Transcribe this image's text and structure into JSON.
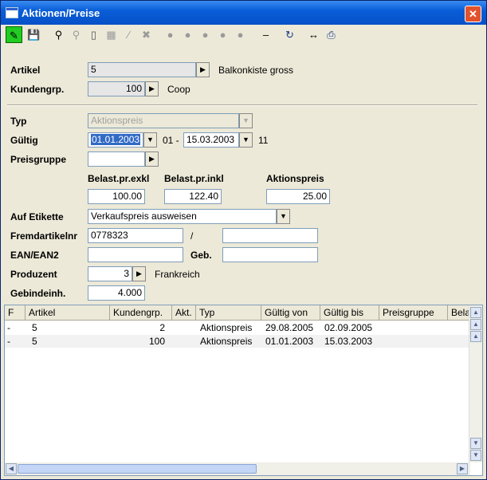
{
  "window": {
    "title": "Aktionen/Preise",
    "close_label": "✕"
  },
  "toolbar": {
    "icons": [
      "edit-icon",
      "save-icon",
      "binoculars-icon",
      "search-icon",
      "new-document-icon",
      "grid-icon",
      "wand-icon",
      "delete-icon",
      "bomb-icon",
      "bomb-icon",
      "bomb-icon",
      "bomb-icon",
      "bomb-icon",
      "minus-icon",
      "refresh-icon",
      "fit-width-icon",
      "print-icon"
    ]
  },
  "form": {
    "artikel": {
      "label": "Artikel",
      "value": "5",
      "description": "Balkonkiste gross"
    },
    "kundengrp": {
      "label": "Kundengrp.",
      "value": "100",
      "description": "Coop"
    },
    "typ": {
      "label": "Typ",
      "value": "Aktionspreis"
    },
    "gueltig": {
      "label": "Gültig",
      "from": "01.01.2003",
      "sep": "01 -",
      "to": "15.03.2003",
      "count": "11"
    },
    "preisgruppe": {
      "label": "Preisgruppe",
      "value": ""
    },
    "belast_exkl": {
      "label": "Belast.pr.exkl",
      "value": "100.00"
    },
    "belast_inkl": {
      "label": "Belast.pr.inkl",
      "value": "122.40"
    },
    "aktionspreis": {
      "label": "Aktionspreis",
      "value": "25.00"
    },
    "etikette": {
      "label": "Auf Etikette",
      "value": "Verkaufspreis ausweisen"
    },
    "fremdartikelnr": {
      "label": "Fremdartikelnr",
      "value": "0778323",
      "slash": "/",
      "value2": ""
    },
    "ean": {
      "label": "EAN/EAN2",
      "value": "",
      "geb_label": "Geb.",
      "geb_value": ""
    },
    "produzent": {
      "label": "Produzent",
      "value": "3",
      "description": "Frankreich"
    },
    "gebindeinh": {
      "label": "Gebindeinh.",
      "value": "4.000"
    }
  },
  "table": {
    "columns": [
      "F",
      "Artikel",
      "Kundengrp.",
      "Akt.",
      "Typ",
      "Gültig von",
      "Gültig bis",
      "Preisgruppe",
      "Bela"
    ],
    "rows": [
      [
        "-",
        "5",
        "2",
        "",
        "Aktionspreis",
        "29.08.2005",
        "02.09.2005",
        "",
        ""
      ],
      [
        "-",
        "5",
        "100",
        "",
        "Aktionspreis",
        "01.01.2003",
        "15.03.2003",
        "",
        ""
      ]
    ]
  },
  "colors": {
    "title_bar": "#0a5ed8",
    "selection": "#316ac5",
    "edit_active": "#22cc22"
  }
}
